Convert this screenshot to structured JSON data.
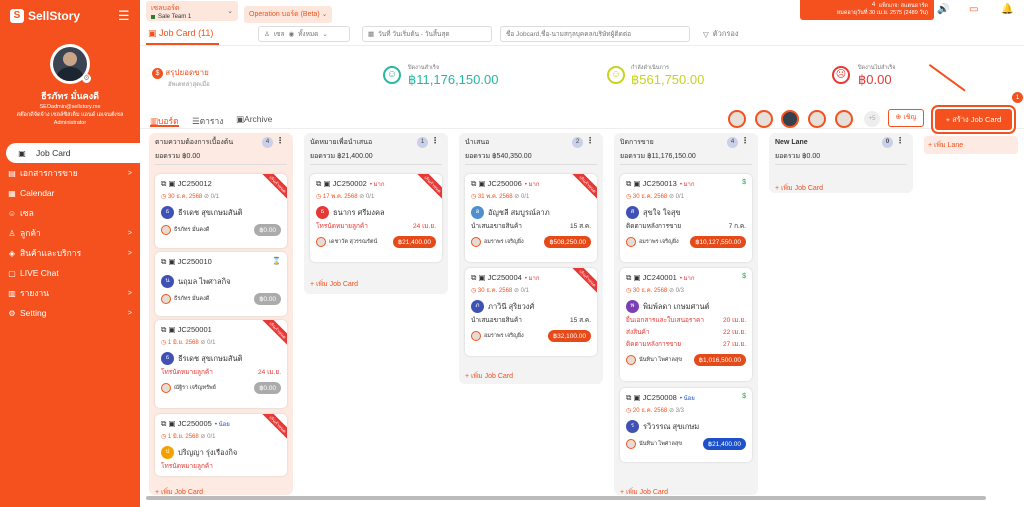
{
  "app": {
    "brand": "SellStory"
  },
  "user": {
    "name": "ธีรภัทร มั่นคงดี",
    "email": "SEOadmin@sellstory.me",
    "company": "สต๊อกดีจัดจ้าง เซลล์ซิสเต็ม แอนด์ เอเจนต์เซล",
    "role": "Administrator"
  },
  "sidebar": {
    "items": [
      {
        "label": "Job Card",
        "icon": "job-card-icon",
        "active": true
      },
      {
        "label": "เอกสารการขาย",
        "icon": "document-icon",
        "chevron": ">"
      },
      {
        "label": "Calendar",
        "icon": "calendar-icon"
      },
      {
        "label": "เซล",
        "icon": "sales-icon"
      },
      {
        "label": "ลูกค้า",
        "icon": "customer-icon",
        "chevron": ">"
      },
      {
        "label": "สินค้าและบริการ",
        "icon": "product-icon",
        "chevron": ">"
      },
      {
        "label": "LIVE Chat",
        "icon": "chat-icon"
      },
      {
        "label": "รายงาน",
        "icon": "report-icon",
        "chevron": ">"
      },
      {
        "label": "Setting",
        "icon": "gear-icon",
        "chevron": ">"
      }
    ]
  },
  "topbar": {
    "team_title": "เซลบอร์ด",
    "team_name": "Sale Team 1",
    "operation": "Operation บอร์ด (Beta)",
    "package_line1": "แพ็กเกจ: สแตนดาร์ด",
    "package_line2": "หมดอายุวันที่ 30 เม.ย. 2575 (2489 วัน)",
    "notif_count": "4"
  },
  "toolbar": {
    "tab_label": "Job Card",
    "tab_count": "(11)",
    "sale_filter": "เซล",
    "sale_value": "ทั้งหมด",
    "date_filter": "วันที่ วันเริ่มต้น - วันสิ้นสุด",
    "search_placeholder": "ชื่อ Jobcard,ชื่อ-นามสกุลบุคคล/บริษัทผู้ติดต่อ",
    "filter_label": "ตัวกรอง"
  },
  "stats": {
    "summary_title": "สรุปยอดขาย",
    "summary_sub": "อัพเดทล่าสุดเมื่อ",
    "closed_label": "ปิดงานสำเร็จ",
    "closed_value": "฿11,176,150.00",
    "ongoing_label": "กำลังดำเนินการ",
    "ongoing_value": "฿561,750.00",
    "failed_label": "ปิดงานไม่สำเร็จ",
    "failed_value": "฿0.00"
  },
  "views": {
    "board": "บอร์ด",
    "table": "ตาราง",
    "archive": "Archive",
    "invite": "เชิญ",
    "create": "+ สร้าง Job Card",
    "create_badge": "1",
    "more": "+5"
  },
  "lanes": [
    {
      "title": "ตามความต้องการเบื้องต้น",
      "count": "4",
      "total": "ยอดรวม ฿0.00",
      "add": "+ เพิ่ม Job Card"
    },
    {
      "title": "นัดหมายเพื่อนำเสนอ",
      "count": "1",
      "total": "ยอดรวม ฿21,400.00",
      "add": "+ เพิ่ม Job Card"
    },
    {
      "title": "นำเสนอ",
      "count": "2",
      "total": "ยอดรวม ฿540,350.00",
      "add": "+ เพิ่ม Job Card"
    },
    {
      "title": "ปิดการขาย",
      "count": "4",
      "total": "ยอดรวม ฿11,176,150.00",
      "add": "+ เพิ่ม Job Card"
    },
    {
      "title": "New Lane",
      "count": "0",
      "total": "ยอดรวม ฿0.00",
      "add": "+ เพิ่ม Job Card"
    }
  ],
  "add_lane": "+ เพิ่ม Lane",
  "cards": {
    "c1": {
      "code": "JC250012",
      "date": "30 ธ.ค. 2568",
      "sub": "0/1",
      "cust": "ธีรเดช สุขเกษมสันติ",
      "initial": "ธ",
      "owner": "ธีรภัทร มั่นคงดี",
      "amount": "฿0.00",
      "ribbon": "เกินกำหนด"
    },
    "c2": {
      "code": "JC250010",
      "cust": "นฤมล ไพศาลกิจ",
      "initial": "น",
      "owner": "ธีรภัทร มั่นคงดี",
      "amount": "฿0.00"
    },
    "c3": {
      "code": "JC250001",
      "date": "1 มิ.ย. 2568",
      "sub": "0/1",
      "cust": "ธีรเดช สุขเกษมสันติ",
      "initial": "ธ",
      "line": "โทรนัดหมายลูกค้า",
      "line_date": "24 เม.ย.",
      "owner": "ณัฐิรา เจริญทรัพย์",
      "amount": "฿0.00",
      "ribbon": "เกินกำหนด"
    },
    "c4": {
      "code": "JC250005",
      "tag": "• น้อย",
      "date": "1 มิ.ย. 2568",
      "sub": "0/1",
      "cust": "ปริญญา รุ่งเรืองกิจ",
      "initial": "ป",
      "line": "โทรนัดหมายลูกค้า",
      "ribbon": "เกินกำหนด"
    },
    "c5": {
      "code": "JC250002",
      "tag": "• มาก",
      "date": "17 พ.ค. 2568",
      "sub": "0/1",
      "cust": "ธนากร ศรีมงคล",
      "initial": "ธ",
      "line": "โทรนัดหมายลูกค้า",
      "line_date": "24 เม.ย.",
      "owner": "เดชาวัต สุวรรณรัตน์",
      "amount": "฿21,400.00",
      "ribbon": "เกินกำหนด"
    },
    "c6": {
      "code": "JC250006",
      "tag": "• มาก",
      "date": "31 พ.ค. 2568",
      "sub": "0/1",
      "cust": "อัญชลี สมบูรณ์ลาภ",
      "initial": "อ",
      "line": "นำเสนอขายสินค้า",
      "line_date": "15 ส.ค.",
      "owner": "อมราพร เจริญยิ่ง",
      "amount": "฿508,250.00",
      "ribbon": "เกินกำหนด"
    },
    "c7": {
      "code": "JC250004",
      "tag": "• มาก",
      "date": "30 ธ.ค. 2568",
      "sub": "0/1",
      "cust": "ภาวินี สุริยวงศ์",
      "initial": "ภ",
      "line": "นำเสนอขายสินค้า",
      "line_date": "15 ส.ค.",
      "owner": "อมราพร เจริญยิ่ง",
      "amount": "฿32,100.00",
      "ribbon": "เกินกำหนด"
    },
    "c8": {
      "code": "JC250013",
      "tag": "• มาก",
      "date": "30 ธ.ค. 2568",
      "sub": "0/1",
      "cust": "สุขใจ ใจสุข",
      "initial": "ส",
      "line": "ติดตามหลังการขาย",
      "line_date": "7 ก.ค.",
      "owner": "อมราพร เจริญยิ่ง",
      "amount": "฿10,127,550.00"
    },
    "c9": {
      "code": "JC240001",
      "tag": "• มาก",
      "date": "30 ธ.ค. 2568",
      "sub": "0/3",
      "cust": "พิมพ์ลดา เกษมศานต์",
      "initial": "พ",
      "l1": "ยื่นเอกสารและใบเสนอราคา",
      "d1": "20 เม.ย.",
      "l2": "ส่งสินค้า",
      "d2": "22 เม.ย.",
      "l3": "ติดตามหลังการขาย",
      "d3": "27 เม.ย.",
      "owner": "นันทินา ไพศาลสุข",
      "amount": "฿1,016,500.00"
    },
    "c10": {
      "code": "JC250008",
      "tag": "• น้อย",
      "date": "20 ธ.ค. 2568",
      "sub": "3/3",
      "cust": "รวิวรรณ สุขเกษม",
      "initial": "ร",
      "owner": "นันทินา ไพศาลสุข",
      "amount": "฿21,400.00"
    }
  },
  "colors": {
    "brand": "#f4511e",
    "success": "#26b8a0",
    "warning": "#c9d21f",
    "danger": "#e53935"
  }
}
